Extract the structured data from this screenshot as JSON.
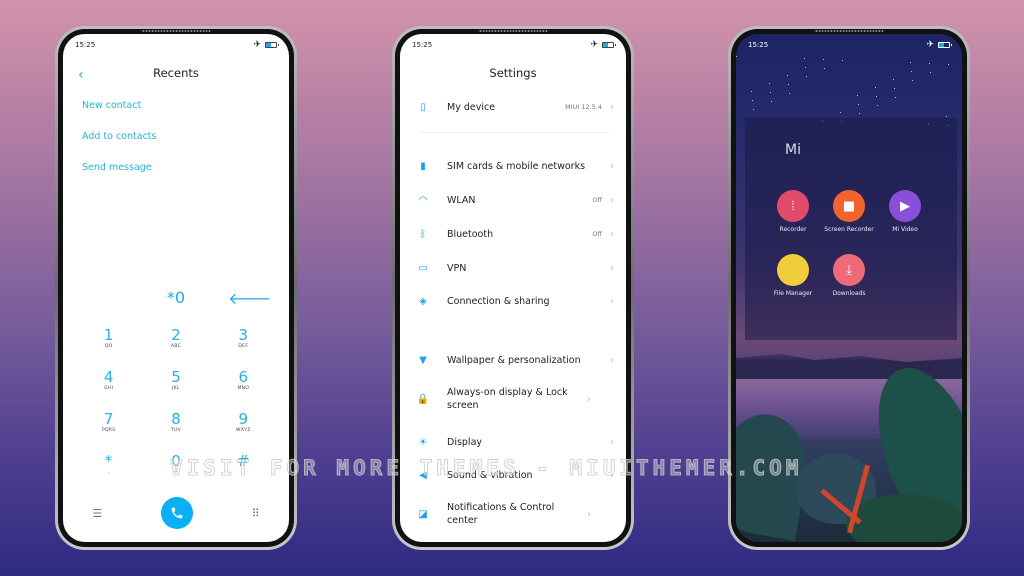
{
  "status_bar": {
    "time": "15:25",
    "airplane_icon": "airplane-icon",
    "battery_icon": "battery-icon"
  },
  "dialer": {
    "title": "Recents",
    "back_icon": "chevron-left-icon",
    "actions": [
      "New contact",
      "Add to contacts",
      "Send message"
    ],
    "entry": "*0",
    "backspace_icon": "backspace-arrow-icon",
    "keys": [
      {
        "digit": "1",
        "letters": "QO"
      },
      {
        "digit": "2",
        "letters": "ABC"
      },
      {
        "digit": "3",
        "letters": "DEF"
      },
      {
        "digit": "4",
        "letters": "GHI"
      },
      {
        "digit": "5",
        "letters": "JKL"
      },
      {
        "digit": "6",
        "letters": "MNO"
      },
      {
        "digit": "7",
        "letters": "PQRS"
      },
      {
        "digit": "8",
        "letters": "TUV"
      },
      {
        "digit": "9",
        "letters": "WXYZ"
      },
      {
        "digit": "*",
        "letters": ","
      },
      {
        "digit": "0",
        "letters": "+"
      },
      {
        "digit": "#",
        "letters": ""
      }
    ],
    "bottom": {
      "menu_icon": "menu-icon",
      "call_icon": "phone-icon",
      "keypad_icon": "dialpad-icon"
    },
    "accent": "#0ab0f5"
  },
  "settings": {
    "title": "Settings",
    "items": [
      {
        "label": "My device",
        "value": "MIUI 12.5.4",
        "icon": "phone-device-icon"
      },
      {
        "label": "SIM cards & mobile networks",
        "value": "",
        "icon": "sim-card-icon"
      },
      {
        "label": "WLAN",
        "value": "Off",
        "icon": "wifi-icon"
      },
      {
        "label": "Bluetooth",
        "value": "Off",
        "icon": "bluetooth-icon"
      },
      {
        "label": "VPN",
        "value": "",
        "icon": "vpn-icon"
      },
      {
        "label": "Connection & sharing",
        "value": "",
        "icon": "connection-sharing-icon"
      },
      {
        "label": "Wallpaper & personalization",
        "value": "",
        "icon": "wallpaper-brush-icon"
      },
      {
        "label": "Always-on display & Lock screen",
        "value": "",
        "icon": "lock-icon"
      },
      {
        "label": "Display",
        "value": "",
        "icon": "brightness-icon"
      },
      {
        "label": "Sound & vibration",
        "value": "",
        "icon": "speaker-icon"
      },
      {
        "label": "Notifications & Control center",
        "value": "",
        "icon": "notification-icon"
      }
    ],
    "accent": "#16a5ea"
  },
  "home": {
    "folder_title": "Mi",
    "apps": [
      {
        "label": "Recorder",
        "color": "#e24a6a",
        "icon": "waveform-icon"
      },
      {
        "label": "Screen Recorder",
        "color": "#f2642d",
        "icon": "video-camera-icon"
      },
      {
        "label": "Mi Video",
        "color": "#8a4fd8",
        "icon": "play-icon"
      },
      {
        "label": "File Manager",
        "color": "#f0cd3a",
        "icon": "folder-icon"
      },
      {
        "label": "Downloads",
        "color": "#ee6a78",
        "icon": "download-icon"
      }
    ]
  },
  "watermark": "VISIT FOR MORE THEMES - MIUITHEMER.COM"
}
